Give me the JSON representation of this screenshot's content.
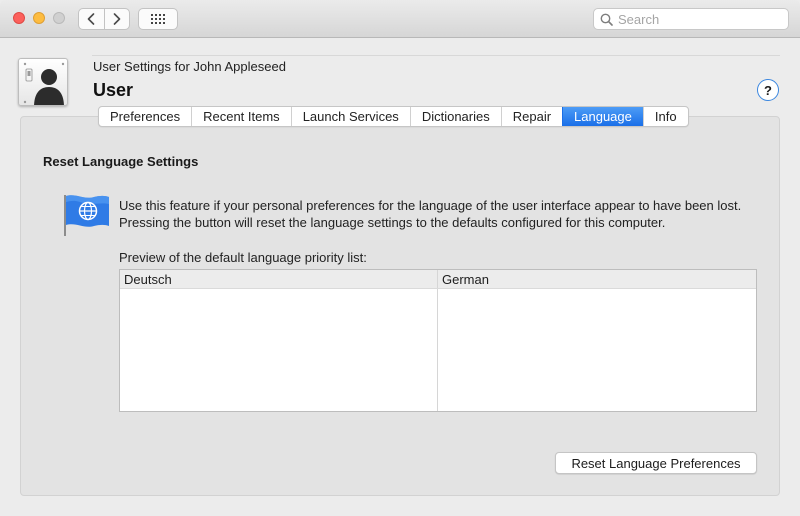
{
  "toolbar": {
    "search_placeholder": "Search",
    "back_icon": "chevron-left-icon",
    "forward_icon": "chevron-right-icon",
    "grid_icon": "show-all-grid-icon"
  },
  "header": {
    "subtitle": "User Settings for John Appleseed",
    "title": "User",
    "help_label": "?"
  },
  "tabs": [
    {
      "label": "Preferences",
      "active": false
    },
    {
      "label": "Recent Items",
      "active": false
    },
    {
      "label": "Launch Services",
      "active": false
    },
    {
      "label": "Dictionaries",
      "active": false
    },
    {
      "label": "Repair",
      "active": false
    },
    {
      "label": "Language",
      "active": true
    },
    {
      "label": "Info",
      "active": false
    }
  ],
  "language": {
    "section_title": "Reset Language Settings",
    "description": "Use this feature if your personal preferences for the language of the user interface appear to have been lost. Pressing the button will reset the language settings to the defaults configured for this computer.",
    "preview_label": "Preview of the default language priority list:",
    "table": {
      "columns": [
        "Deutsch",
        "German"
      ],
      "rows": []
    },
    "reset_button": "Reset Language Preferences"
  },
  "colors": {
    "accent": "#1a6fe8",
    "close": "#fc605c",
    "minimize": "#fdbc40",
    "zoom_disabled": "#d0d0d0"
  }
}
